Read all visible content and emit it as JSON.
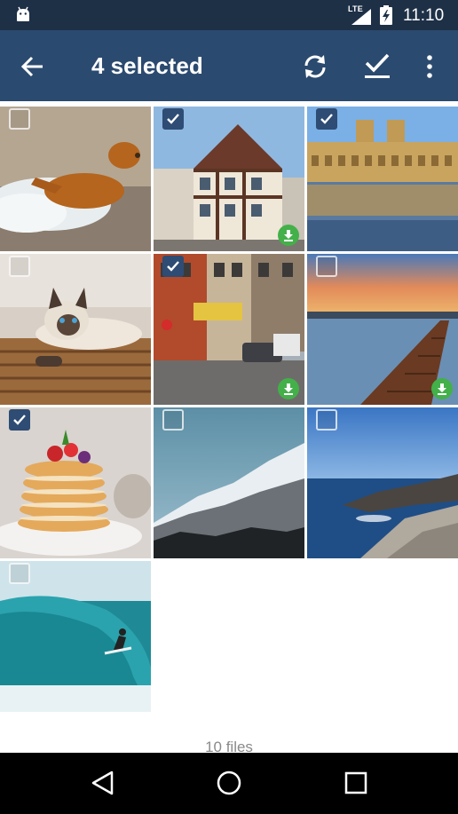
{
  "status_bar": {
    "network": "LTE",
    "time": "11:10",
    "icons": [
      "android-icon",
      "signal-icon",
      "battery-charging-icon"
    ]
  },
  "app_bar": {
    "title": "4 selected",
    "icons": [
      "back-arrow-icon",
      "sync-icon",
      "select-all-icon",
      "more-vert-icon"
    ]
  },
  "photos": [
    {
      "subject": "dog running in water",
      "selected": false,
      "downloaded": false
    },
    {
      "subject": "half-timbered house",
      "selected": true,
      "downloaded": true
    },
    {
      "subject": "palace reflected in water",
      "selected": true,
      "downloaded": false
    },
    {
      "subject": "siamese cat on basket",
      "selected": false,
      "downloaded": false
    },
    {
      "subject": "city street",
      "selected": true,
      "downloaded": true
    },
    {
      "subject": "pier at sunset",
      "selected": false,
      "downloaded": true
    },
    {
      "subject": "pancake stack",
      "selected": true,
      "downloaded": false
    },
    {
      "subject": "snowy mountain",
      "selected": false,
      "downloaded": false
    },
    {
      "subject": "rocky coastline",
      "selected": false,
      "downloaded": false
    },
    {
      "subject": "surfer on wave",
      "selected": false,
      "downloaded": false
    }
  ],
  "footer": {
    "file_count": "10 files"
  },
  "nav_bar": {
    "icons": [
      "nav-back-icon",
      "nav-home-icon",
      "nav-recents-icon"
    ]
  },
  "colors": {
    "status_bar": "#1e3046",
    "app_bar": "#2b4a6f",
    "checkbox_checked": "#2e4c74",
    "download_badge": "#43b04a"
  }
}
